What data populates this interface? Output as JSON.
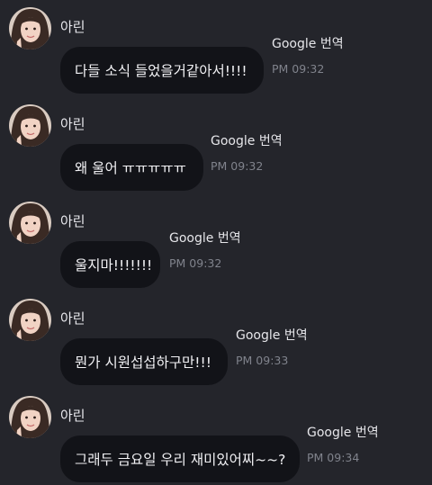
{
  "messages": [
    {
      "sender": "아린",
      "text": "다들 소식 들었을거같아서!!!!",
      "translate_label": "Google 번역",
      "time": "PM 09:32"
    },
    {
      "sender": "아린",
      "text": "왜 울어 ㅠㅠㅠㅠㅠ",
      "translate_label": "Google 번역",
      "time": "PM 09:32"
    },
    {
      "sender": "아린",
      "text": "울지마!!!!!!!",
      "translate_label": "Google 번역",
      "time": "PM 09:32"
    },
    {
      "sender": "아린",
      "text": "뭔가 시원섭섭하구만!!!",
      "translate_label": "Google 번역",
      "time": "PM 09:33"
    },
    {
      "sender": "아린",
      "text": "그래두 금요일 우리 재미있어찌~~?",
      "translate_label": "Google 번역",
      "time": "PM 09:34"
    }
  ]
}
